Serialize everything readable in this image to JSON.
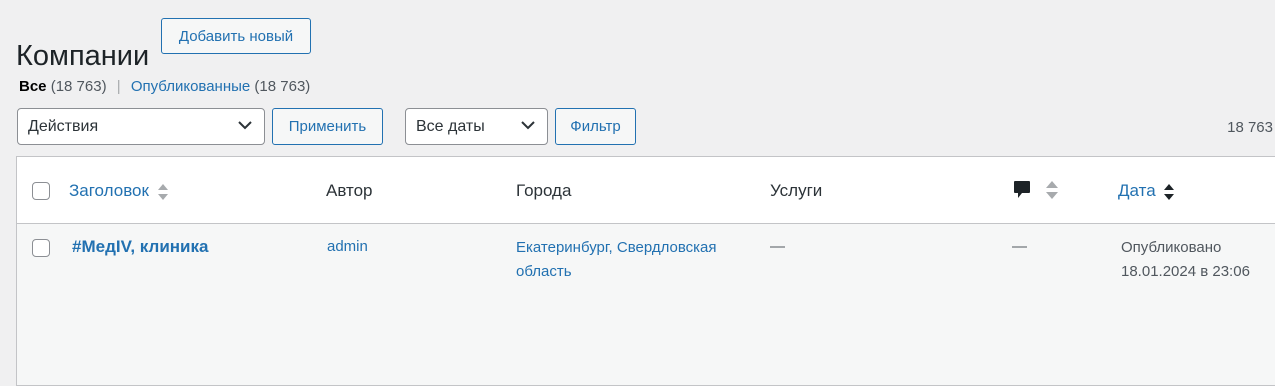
{
  "page": {
    "title": "Компании",
    "add_new": "Добавить новый"
  },
  "views": {
    "all_label": "Все",
    "all_count": "(18 763)",
    "separator": "|",
    "published_label": "Опубликованные",
    "published_count": "(18 763)"
  },
  "tablenav": {
    "bulk_action_selected": "Действия",
    "apply_label": "Применить",
    "date_filter_selected": "Все даты",
    "filter_label": "Фильтр",
    "items_count": "18 763"
  },
  "columns": {
    "title": "Заголовок",
    "author": "Автор",
    "cities": "Города",
    "services": "Услуги",
    "comments_icon": "comment-bubble-icon",
    "date": "Дата"
  },
  "rows": [
    {
      "title": "#МедIV, клиника",
      "author": "admin",
      "cities": "Екатеринбург, Свердловская область",
      "services": "—",
      "comments": "—",
      "date_status": "Опубликовано",
      "date_value": "18.01.2024 в 23:06"
    }
  ],
  "colors": {
    "link": "#2271b1",
    "background": "#f0f0f1",
    "text": "#1d2327"
  }
}
